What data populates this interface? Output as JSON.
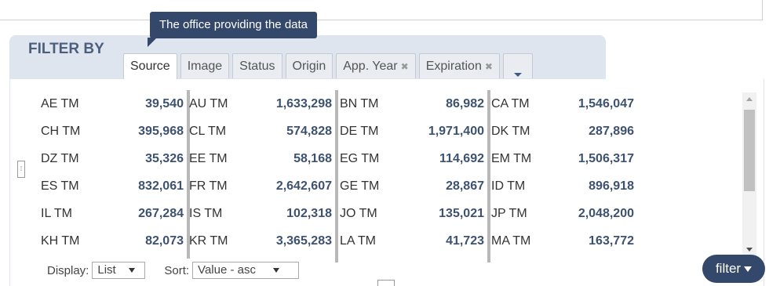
{
  "tooltip": "The office providing the data",
  "header": {
    "title": "FILTER BY"
  },
  "tabs": [
    {
      "label": "Source",
      "active": true,
      "removable": false
    },
    {
      "label": "Image",
      "active": false,
      "removable": false
    },
    {
      "label": "Status",
      "active": false,
      "removable": false
    },
    {
      "label": "Origin",
      "active": false,
      "removable": false
    },
    {
      "label": "App. Year",
      "active": false,
      "removable": true
    },
    {
      "label": "Expiration",
      "active": false,
      "removable": true
    }
  ],
  "remove_glyph": "✖",
  "columns": [
    [
      {
        "name": "AE TM",
        "value": "39,540"
      },
      {
        "name": "CH TM",
        "value": "395,968"
      },
      {
        "name": "DZ TM",
        "value": "35,326"
      },
      {
        "name": "ES TM",
        "value": "832,061"
      },
      {
        "name": "IL TM",
        "value": "267,284"
      },
      {
        "name": "KH TM",
        "value": "82,073"
      }
    ],
    [
      {
        "name": "AU TM",
        "value": "1,633,298"
      },
      {
        "name": "CL TM",
        "value": "574,828"
      },
      {
        "name": "EE TM",
        "value": "58,168"
      },
      {
        "name": "FR TM",
        "value": "2,642,607"
      },
      {
        "name": "IS TM",
        "value": "102,318"
      },
      {
        "name": "KR TM",
        "value": "3,365,283"
      }
    ],
    [
      {
        "name": "BN TM",
        "value": "86,982"
      },
      {
        "name": "DE TM",
        "value": "1,971,400"
      },
      {
        "name": "EG TM",
        "value": "114,692"
      },
      {
        "name": "GE TM",
        "value": "28,867"
      },
      {
        "name": "JO TM",
        "value": "135,021"
      },
      {
        "name": "LA TM",
        "value": "41,723"
      }
    ],
    [
      {
        "name": "CA TM",
        "value": "1,546,047"
      },
      {
        "name": "DK TM",
        "value": "287,896"
      },
      {
        "name": "EM TM",
        "value": "1,506,317"
      },
      {
        "name": "ID TM",
        "value": "896,918"
      },
      {
        "name": "JP TM",
        "value": "2,048,200"
      },
      {
        "name": "MA TM",
        "value": "163,772"
      }
    ]
  ],
  "controls": {
    "display_label": "Display:",
    "display_value": "List",
    "sort_label": "Sort:",
    "sort_value": "Value - asc"
  },
  "filter_button": "filter",
  "colors": {
    "accent": "#33486a",
    "panel": "#dfe5ee",
    "value_text": "#3d5270"
  }
}
